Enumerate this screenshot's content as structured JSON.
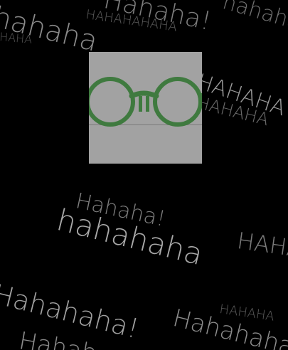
{
  "background_color": "#000000",
  "text_color": "#8a8a8a",
  "frame_color": "#3f7a3f",
  "photo_background": "#a2a2a2",
  "photo_icon": "round-eyeglasses-icon",
  "laughs": [
    "Hahaha!",
    "hahaha",
    "HAHAHAHAHA",
    "HAHA",
    "hahaha",
    "HAHAHA",
    "HAHAHA",
    "Hahaha!",
    "hahahaha",
    "HAHA",
    "Hahahaha!",
    "HAHAHA",
    "Hahahaha",
    "Hahah"
  ]
}
